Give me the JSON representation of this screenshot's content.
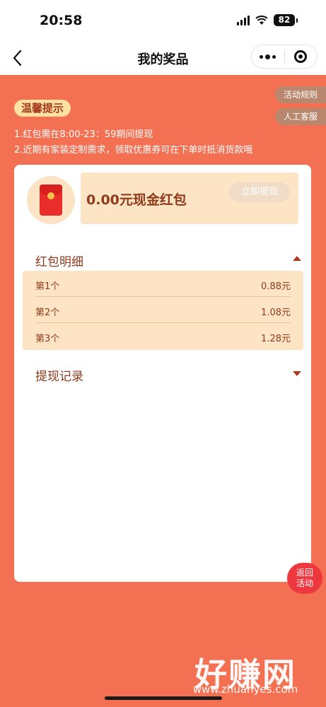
{
  "status_bar": {
    "time": "20:58",
    "battery": "82"
  },
  "nav": {
    "title": "我的奖品"
  },
  "side_tags": {
    "rules": "活动规则",
    "service": "人工客服"
  },
  "tips": {
    "badge": "温馨提示",
    "line1": "1.红包需在8:00-23：59期间提现",
    "line2": "2.近期有家装定制需求，领取优惠券可在下单时抵消货款哦"
  },
  "cash": {
    "title": "0.00元现金红包",
    "withdraw_label": "立即提现"
  },
  "detail": {
    "label": "红包明细",
    "rows": [
      {
        "name": "第1个",
        "value": "0.88元"
      },
      {
        "name": "第2个",
        "value": "1.08元"
      },
      {
        "name": "第3个",
        "value": "1.28元"
      }
    ]
  },
  "record": {
    "label": "提现记录"
  },
  "back_button": {
    "line1": "返回",
    "line2": "活动"
  },
  "watermark": {
    "text": "好赚网",
    "url": "www.zhuanyes.com"
  },
  "colors": {
    "background": "#f47052",
    "accent_brown": "#8e3b1c",
    "pale_peach": "#fde4c4"
  }
}
